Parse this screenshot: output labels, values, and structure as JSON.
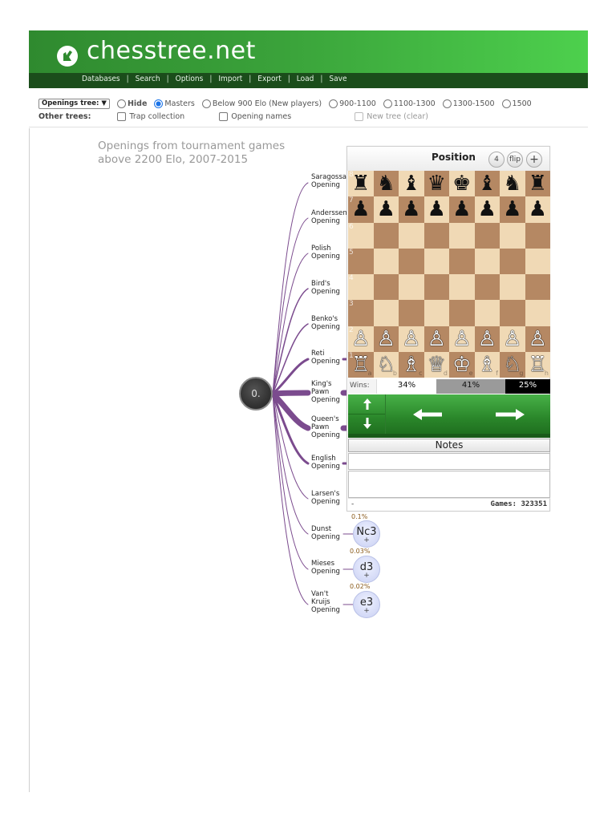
{
  "header": {
    "logo_text": "chesstree.net",
    "nav": [
      "Databases",
      "Search",
      "Options",
      "Import",
      "Export",
      "Load",
      "Save"
    ]
  },
  "options": {
    "tree_select": "Openings tree:",
    "radios": [
      {
        "label": "Hide",
        "selected": false
      },
      {
        "label": "Masters",
        "selected": true
      },
      {
        "label": "Below 900 Elo (New players)",
        "selected": false
      },
      {
        "label": "900-1100",
        "selected": false
      },
      {
        "label": "1100-1300",
        "selected": false
      },
      {
        "label": "1300-1500",
        "selected": false
      },
      {
        "label": "1500",
        "selected": false
      }
    ],
    "other_trees_label": "Other trees:",
    "checkboxes": [
      {
        "label": "Trap collection",
        "disabled": false
      },
      {
        "label": "Opening names",
        "disabled": false
      },
      {
        "label": "New tree (clear)",
        "disabled": true
      }
    ]
  },
  "caption": {
    "line1": "Openings from tournament games",
    "line2": "above 2200 Elo, 2007-2015"
  },
  "tree": {
    "root_label": "0.",
    "openings": [
      {
        "name": "Saragossa Opening"
      },
      {
        "name": "Anderssen Opening"
      },
      {
        "name": "Polish Opening"
      },
      {
        "name": "Bird's Opening"
      },
      {
        "name": "Benko's Opening"
      },
      {
        "name": "Reti Opening"
      },
      {
        "name": "King's Pawn Opening"
      },
      {
        "name": "Queen's Pawn Opening"
      },
      {
        "name": "English Opening"
      },
      {
        "name": "Larsen's Opening"
      },
      {
        "name": "Dunst Opening",
        "move": "Nc3",
        "pct": "0.1%"
      },
      {
        "name": "Mieses Opening",
        "move": "d3",
        "pct": "0.03%"
      },
      {
        "name": "Van't Kruijs Opening",
        "move": "e3",
        "pct": "0.02%"
      }
    ],
    "plus": "+"
  },
  "panel": {
    "title": "Position",
    "btn_flip": "flip",
    "btn_plus": "+",
    "btn_clock": "4",
    "wins_label": "Wins:",
    "wins_white": "34%",
    "wins_draw": "41%",
    "wins_black": "25%",
    "notes": "Notes",
    "notes_dash": "-",
    "games": "Games: 323351",
    "board": [
      [
        "♜",
        "♞",
        "♝",
        "♛",
        "♚",
        "♝",
        "♞",
        "♜"
      ],
      [
        "♟",
        "♟",
        "♟",
        "♟",
        "♟",
        "♟",
        "♟",
        "♟"
      ],
      [
        "",
        "",
        "",
        "",
        "",
        "",
        "",
        ""
      ],
      [
        "",
        "",
        "",
        "",
        "",
        "",
        "",
        ""
      ],
      [
        "",
        "",
        "",
        "",
        "",
        "",
        "",
        ""
      ],
      [
        "",
        "",
        "",
        "",
        "",
        "",
        "",
        ""
      ],
      [
        "♙",
        "♙",
        "♙",
        "♙",
        "♙",
        "♙",
        "♙",
        "♙"
      ],
      [
        "♖",
        "♘",
        "♗",
        "♕",
        "♔",
        "♗",
        "♘",
        "♖"
      ]
    ],
    "ranks": [
      "8",
      "7",
      "6",
      "5",
      "4",
      "3",
      "2",
      "1"
    ],
    "files": [
      "a",
      "b",
      "c",
      "d",
      "e",
      "f",
      "g",
      "h"
    ]
  },
  "colors": {
    "header_green": "#3aa23a",
    "nav_dark": "#1b4d1b",
    "branch_purple": "#7b4b8e",
    "light_square": "#f0d9b5",
    "dark_square": "#b58863"
  }
}
